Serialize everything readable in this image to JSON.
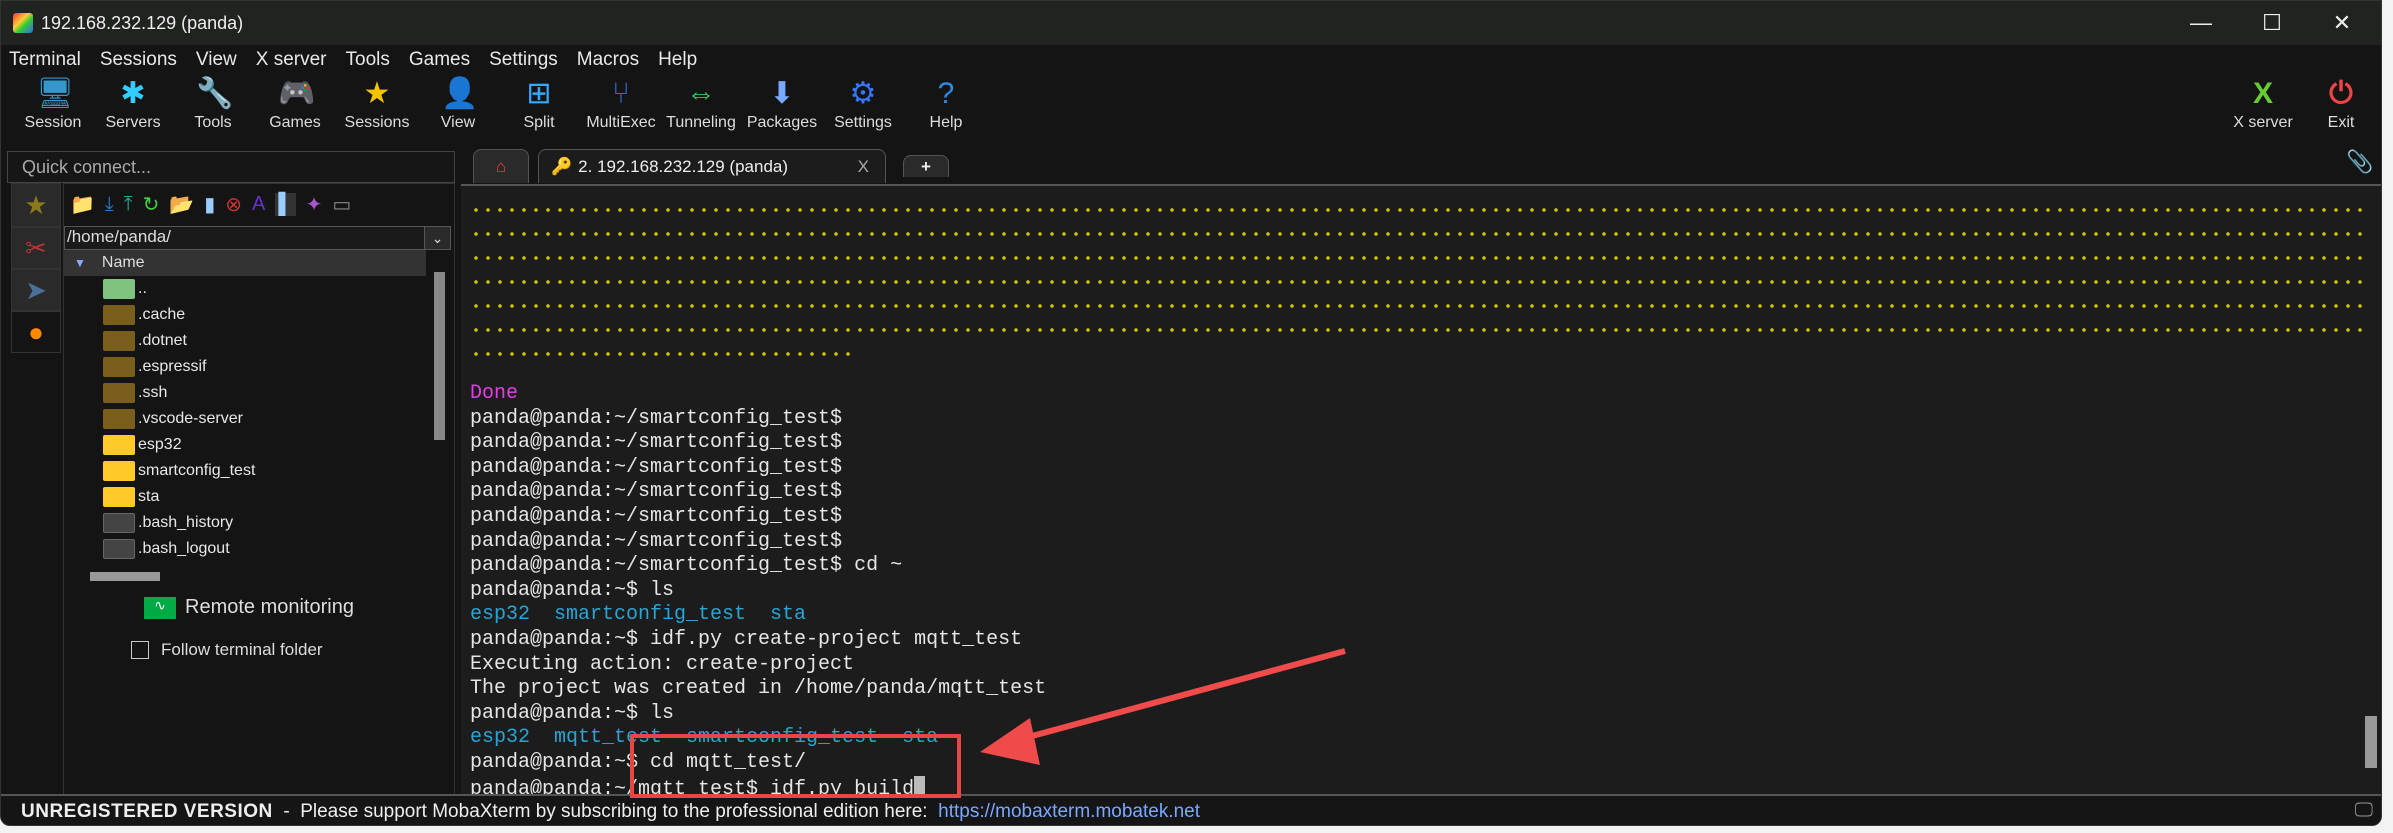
{
  "window": {
    "title": "192.168.232.129 (panda)",
    "minimize": "—",
    "maximize": "☐",
    "close": "✕"
  },
  "menu": [
    "Terminal",
    "Sessions",
    "View",
    "X server",
    "Tools",
    "Games",
    "Settings",
    "Macros",
    "Help"
  ],
  "toolbar": [
    {
      "label": "Session",
      "icon": "🖥"
    },
    {
      "label": "Servers",
      "icon": "✱"
    },
    {
      "label": "Tools",
      "icon": "🔧"
    },
    {
      "label": "Games",
      "icon": "🎮"
    },
    {
      "label": "Sessions",
      "icon": "★"
    },
    {
      "label": "View",
      "icon": "👤"
    },
    {
      "label": "Split",
      "icon": "⊞"
    },
    {
      "label": "MultiExec",
      "icon": "⑂"
    },
    {
      "label": "Tunneling",
      "icon": "⇔"
    },
    {
      "label": "Packages",
      "icon": "⬇"
    },
    {
      "label": "Settings",
      "icon": "⚙"
    },
    {
      "label": "Help",
      "icon": "?"
    }
  ],
  "toolbar_right": [
    {
      "label": "X server",
      "icon": "X"
    },
    {
      "label": "Exit",
      "icon": "⏻"
    }
  ],
  "quick_connect": {
    "placeholder": "Quick connect..."
  },
  "tabs": {
    "home_icon": "⌂",
    "active": "2. 192.168.232.129 (panda)",
    "close": "X",
    "new": "+"
  },
  "sftp": {
    "path": "/home/panda/",
    "column": "Name",
    "files": [
      {
        "name": "..",
        "kind": "up"
      },
      {
        "name": ".cache",
        "kind": "hidden"
      },
      {
        "name": ".dotnet",
        "kind": "hidden"
      },
      {
        "name": ".espressif",
        "kind": "hidden"
      },
      {
        "name": ".ssh",
        "kind": "hidden"
      },
      {
        "name": ".vscode-server",
        "kind": "hidden"
      },
      {
        "name": "esp32",
        "kind": "folder"
      },
      {
        "name": "smartconfig_test",
        "kind": "folder"
      },
      {
        "name": "sta",
        "kind": "folder"
      },
      {
        "name": ".bash_history",
        "kind": "file"
      },
      {
        "name": ".bash_logout",
        "kind": "file"
      }
    ],
    "remote_monitoring": "Remote monitoring",
    "follow_folder": "Follow terminal folder"
  },
  "terminal": {
    "lines": [
      {
        "t": "Done",
        "c": "mag"
      },
      {
        "t": "panda@panda:~/smartconfig_test$"
      },
      {
        "t": "panda@panda:~/smartconfig_test$"
      },
      {
        "t": "panda@panda:~/smartconfig_test$"
      },
      {
        "t": "panda@panda:~/smartconfig_test$"
      },
      {
        "t": "panda@panda:~/smartconfig_test$"
      },
      {
        "t": "panda@panda:~/smartconfig_test$"
      },
      {
        "t": "panda@panda:~/smartconfig_test$ cd ~"
      },
      {
        "t": "panda@panda:~$ ls"
      },
      {
        "t": "esp32  smartconfig_test  sta",
        "c": "blue"
      },
      {
        "t": "panda@panda:~$ idf.py create-project mqtt_test"
      },
      {
        "t": "Executing action: create-project"
      },
      {
        "t": "The project was created in /home/panda/mqtt_test"
      },
      {
        "t": "panda@panda:~$ ls"
      },
      {
        "t": "esp32  mqtt_test  smartconfig_test  sta",
        "c": "blue"
      },
      {
        "t": "panda@panda:~$ cd mqtt_test/"
      },
      {
        "t": "panda@panda:~/mqtt_test$ idf.py build",
        "cursor": true
      }
    ]
  },
  "status": {
    "unregistered": "UNREGISTERED VERSION",
    "message": "  -  Please support MobaXterm by subscribing to the professional edition here:  ",
    "link": "https://mobaxterm.mobatek.net"
  }
}
